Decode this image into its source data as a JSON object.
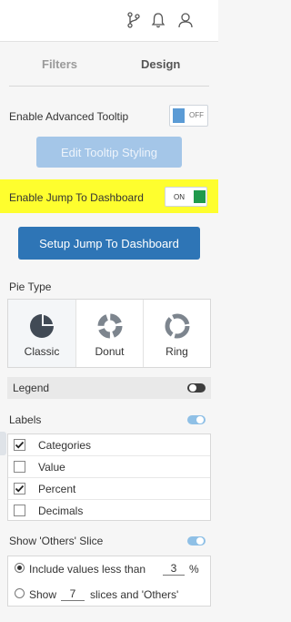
{
  "header": {
    "icons": [
      "branch-icon",
      "bell-icon",
      "user-icon"
    ]
  },
  "tabs": [
    {
      "label": "Filters"
    },
    {
      "label": "Design"
    }
  ],
  "settings": {
    "advanced_tooltip": {
      "label": "Enable Advanced Tooltip",
      "state": "OFF"
    },
    "edit_tooltip_button": "Edit Tooltip Styling",
    "jump_to_dashboard": {
      "label": "Enable Jump To Dashboard",
      "state": "ON"
    },
    "setup_jump_button": "Setup Jump To Dashboard"
  },
  "pie_type": {
    "label": "Pie Type",
    "options": [
      {
        "label": "Classic",
        "selected": true
      },
      {
        "label": "Donut",
        "selected": false
      },
      {
        "label": "Ring",
        "selected": false
      }
    ]
  },
  "legend": {
    "label": "Legend",
    "enabled": false
  },
  "labels": {
    "label": "Labels",
    "enabled": true,
    "items": [
      {
        "label": "Categories",
        "checked": true
      },
      {
        "label": "Value",
        "checked": false
      },
      {
        "label": "Percent",
        "checked": true
      },
      {
        "label": "Decimals",
        "checked": false
      }
    ]
  },
  "others_slice": {
    "label": "Show 'Others' Slice",
    "enabled": true,
    "include_less_than": {
      "before": "Include values less than",
      "value": "3",
      "after": "%",
      "selected": true
    },
    "show_slices": {
      "before": "Show",
      "value": "7",
      "after": "slices and 'Others'",
      "selected": false
    }
  },
  "colors": {
    "primary": "#2e75b6",
    "highlight": "#fefe2e",
    "on": "#1f9a4c",
    "toggle_blue": "#5b9bd5"
  }
}
